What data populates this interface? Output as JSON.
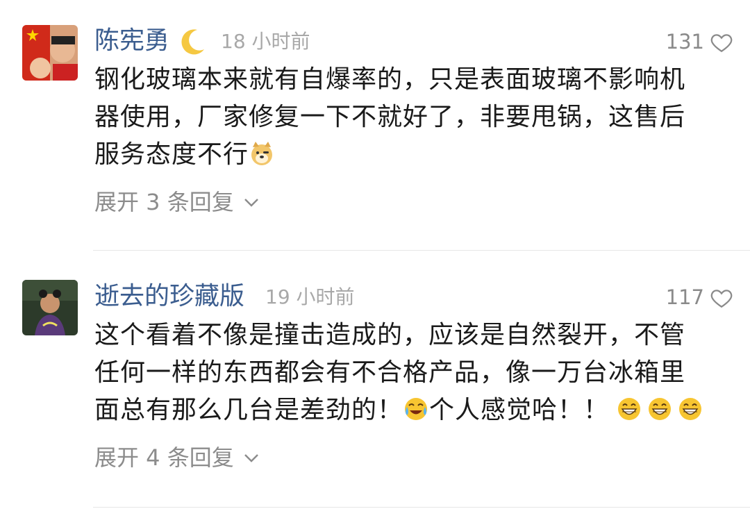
{
  "comments": [
    {
      "username": "陈宪勇",
      "badge": "🌙",
      "time": "18 小时前",
      "likes": "131",
      "lines": [
        "钢化玻璃本来就有自爆率的，只是表面玻璃不影响机",
        "器使用，厂家修复一下不就好了，非要甩锅，这售后",
        "服务态度不行"
      ],
      "trailing_emoji": "doge-icon",
      "expand_label": "展开 3 条回复"
    },
    {
      "username": "逝去的珍藏版",
      "time": "19 小时前",
      "likes": "117",
      "lines": [
        "这个看着不像是撞击造成的，应该是自然裂开，不管",
        "任何一样的东西都会有不合格产品，像一万台冰箱里"
      ],
      "line3_a": "面总有那么几台是差劲的！",
      "line3_b": "个人感觉哈！！",
      "emojis": [
        "laugh-cry-icon",
        "grin-icon",
        "grin-icon",
        "grin-icon"
      ],
      "expand_label": "展开 4 条回复"
    }
  ],
  "colors": {
    "username": "#3b5d8f",
    "meta": "#a8a8a8",
    "text": "#1a1a1a",
    "divider": "#e6e6e6"
  }
}
